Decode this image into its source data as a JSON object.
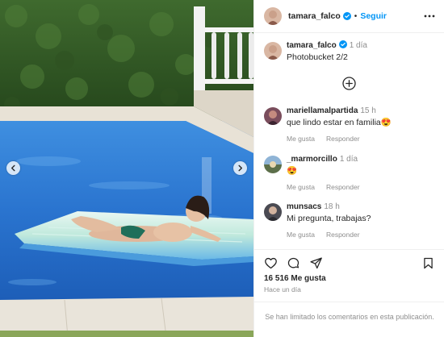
{
  "post": {
    "username": "tamara_falco",
    "verified_icon": "verified-badge-icon",
    "follow_label": "Seguir",
    "separator": "•",
    "more_icon": "more-horizontal-icon"
  },
  "caption": {
    "username": "tamara_falco",
    "time": "1 día",
    "text": "Photobucket 2/2"
  },
  "load_more_icon": "plus-circle-icon",
  "comments": [
    {
      "username": "mariellamalpartida",
      "time": "15 h",
      "text": "que lindo estar en familia😍",
      "like_label": "Me gusta",
      "reply_label": "Responder"
    },
    {
      "username": "_marmorcillo",
      "time": "1 día",
      "text": "😍",
      "like_label": "Me gusta",
      "reply_label": "Responder"
    },
    {
      "username": "munsacs",
      "time": "18 h",
      "text": "Mi pregunta, trabajas?",
      "like_label": "Me gusta",
      "reply_label": "Responder"
    }
  ],
  "actions": {
    "icons": [
      "heart-icon",
      "comment-icon",
      "share-icon",
      "bookmark-icon"
    ],
    "likes": "16 516 Me gusta",
    "timestamp": "Hace un día"
  },
  "limited_notice": "Se han limitado los comentarios en esta publicación.",
  "colors": {
    "accent": "#0095f6",
    "text": "#262626",
    "secondary": "#8e8e8e",
    "pool": "#2b6fc2"
  }
}
